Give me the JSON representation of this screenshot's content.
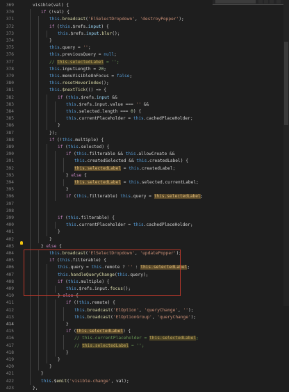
{
  "editor": {
    "active_line": 414,
    "find_widget": {
      "query": "this.selectedLabel"
    },
    "lines": [
      {
        "n": "369",
        "i": 1,
        "t": [
          [
            "p",
            "visible(val) {"
          ]
        ]
      },
      {
        "n": "370",
        "i": 2,
        "t": [
          [
            "c",
            "if"
          ],
          [
            "p",
            " (!val) {"
          ]
        ]
      },
      {
        "n": "371",
        "i": 3,
        "t": [
          [
            "k",
            "this"
          ],
          [
            "p",
            "."
          ],
          [
            "f",
            "broadcast"
          ],
          [
            "p",
            "("
          ],
          [
            "s",
            "'ElSelectDropdown'"
          ],
          [
            "p",
            ", "
          ],
          [
            "s",
            "'destroyPopper'"
          ],
          [
            "p",
            ");"
          ]
        ]
      },
      {
        "n": "372",
        "i": 3,
        "t": [
          [
            "c",
            "if"
          ],
          [
            "p",
            " ("
          ],
          [
            "k",
            "this"
          ],
          [
            "p",
            ".$refs."
          ],
          [
            "v",
            "input"
          ],
          [
            "p",
            ") {"
          ]
        ]
      },
      {
        "n": "373",
        "i": 4,
        "t": [
          [
            "k",
            "this"
          ],
          [
            "p",
            ".$refs."
          ],
          [
            "v",
            "input"
          ],
          [
            "p",
            "."
          ],
          [
            "f",
            "blur"
          ],
          [
            "p",
            "();"
          ]
        ]
      },
      {
        "n": "374",
        "i": 3,
        "t": [
          [
            "p",
            "}"
          ]
        ]
      },
      {
        "n": "375",
        "i": 3,
        "t": [
          [
            "k",
            "this"
          ],
          [
            "p",
            ".query = "
          ],
          [
            "s",
            "''"
          ],
          [
            "p",
            ";"
          ]
        ]
      },
      {
        "n": "376",
        "i": 3,
        "t": [
          [
            "k",
            "this"
          ],
          [
            "p",
            ".previousQuery = "
          ],
          [
            "k",
            "null"
          ],
          [
            "p",
            ";"
          ]
        ]
      },
      {
        "n": "377",
        "i": 3,
        "t": [
          [
            "cm",
            "// "
          ],
          [
            "hlc",
            "this.selectedLabel"
          ],
          [
            "cm",
            " = '';"
          ]
        ]
      },
      {
        "n": "378",
        "i": 3,
        "t": [
          [
            "k",
            "this"
          ],
          [
            "p",
            ".inputLength = "
          ],
          [
            "n",
            "20"
          ],
          [
            "p",
            ";"
          ]
        ]
      },
      {
        "n": "379",
        "i": 3,
        "t": [
          [
            "k",
            "this"
          ],
          [
            "p",
            ".menuVisibleOnFocus = "
          ],
          [
            "k",
            "false"
          ],
          [
            "p",
            ";"
          ]
        ]
      },
      {
        "n": "380",
        "i": 3,
        "t": [
          [
            "k",
            "this"
          ],
          [
            "p",
            "."
          ],
          [
            "f",
            "resetHoverIndex"
          ],
          [
            "p",
            "();"
          ]
        ]
      },
      {
        "n": "381",
        "i": 3,
        "t": [
          [
            "k",
            "this"
          ],
          [
            "p",
            "."
          ],
          [
            "f",
            "$nextTick"
          ],
          [
            "p",
            "(() => {"
          ]
        ]
      },
      {
        "n": "382",
        "i": 4,
        "t": [
          [
            "c",
            "if"
          ],
          [
            "p",
            " ("
          ],
          [
            "k",
            "this"
          ],
          [
            "p",
            ".$refs."
          ],
          [
            "v",
            "input"
          ],
          [
            "p",
            " &&"
          ]
        ]
      },
      {
        "n": "383",
        "i": 5,
        "t": [
          [
            "k",
            "this"
          ],
          [
            "p",
            ".$refs.input.value === "
          ],
          [
            "s",
            "''"
          ],
          [
            "p",
            " &&"
          ]
        ]
      },
      {
        "n": "384",
        "i": 5,
        "t": [
          [
            "k",
            "this"
          ],
          [
            "p",
            ".selected.length === "
          ],
          [
            "n",
            "0"
          ],
          [
            "p",
            ") {"
          ]
        ]
      },
      {
        "n": "385",
        "i": 5,
        "t": [
          [
            "k",
            "this"
          ],
          [
            "p",
            ".currentPlaceholder = "
          ],
          [
            "k",
            "this"
          ],
          [
            "p",
            ".cachedPlaceHolder;"
          ]
        ]
      },
      {
        "n": "386",
        "i": 4,
        "t": [
          [
            "p",
            "}"
          ]
        ]
      },
      {
        "n": "387",
        "i": 3,
        "t": [
          [
            "p",
            "});"
          ]
        ]
      },
      {
        "n": "388",
        "i": 3,
        "t": [
          [
            "c",
            "if"
          ],
          [
            "p",
            " (!"
          ],
          [
            "k",
            "this"
          ],
          [
            "p",
            ".multiple) {"
          ]
        ]
      },
      {
        "n": "389",
        "i": 4,
        "t": [
          [
            "c",
            "if"
          ],
          [
            "p",
            " ("
          ],
          [
            "k",
            "this"
          ],
          [
            "p",
            ".selected) {"
          ]
        ]
      },
      {
        "n": "390",
        "i": 5,
        "t": [
          [
            "c",
            "if"
          ],
          [
            "p",
            " ("
          ],
          [
            "k",
            "this"
          ],
          [
            "p",
            ".filterable && "
          ],
          [
            "k",
            "this"
          ],
          [
            "p",
            ".allowCreate &&"
          ]
        ]
      },
      {
        "n": "391",
        "i": 6,
        "t": [
          [
            "k",
            "this"
          ],
          [
            "p",
            ".createdSelected && "
          ],
          [
            "k",
            "this"
          ],
          [
            "p",
            ".createdLabel) {"
          ]
        ]
      },
      {
        "n": "392",
        "i": 6,
        "t": [
          [
            "hl",
            "this.selectedLabel"
          ],
          [
            "p",
            " = "
          ],
          [
            "k",
            "this"
          ],
          [
            "p",
            ".createdLabel;"
          ]
        ]
      },
      {
        "n": "393",
        "i": 5,
        "t": [
          [
            "p",
            "} "
          ],
          [
            "c",
            "else"
          ],
          [
            "p",
            " {"
          ]
        ]
      },
      {
        "n": "394",
        "i": 6,
        "t": [
          [
            "hl",
            "this.selectedLabel"
          ],
          [
            "p",
            " = "
          ],
          [
            "k",
            "this"
          ],
          [
            "p",
            ".selected.currentLabel;"
          ]
        ]
      },
      {
        "n": "395",
        "i": 5,
        "t": [
          [
            "p",
            "}"
          ]
        ]
      },
      {
        "n": "396",
        "i": 5,
        "t": [
          [
            "c",
            "if"
          ],
          [
            "p",
            " ("
          ],
          [
            "k",
            "this"
          ],
          [
            "p",
            ".filterable) "
          ],
          [
            "k",
            "this"
          ],
          [
            "p",
            ".query = "
          ],
          [
            "hl",
            "this.selectedLabel"
          ],
          [
            "p",
            ";"
          ]
        ]
      },
      {
        "n": "397",
        "i": 4,
        "t": []
      },
      {
        "n": "398",
        "i": 4,
        "t": []
      },
      {
        "n": "399",
        "i": 4,
        "t": [
          [
            "c",
            "if"
          ],
          [
            "p",
            " ("
          ],
          [
            "k",
            "this"
          ],
          [
            "p",
            ".filterable) {"
          ]
        ]
      },
      {
        "n": "400",
        "i": 5,
        "t": [
          [
            "k",
            "this"
          ],
          [
            "p",
            ".currentPlaceholder = "
          ],
          [
            "k",
            "this"
          ],
          [
            "p",
            ".cachedPlaceHolder;"
          ]
        ]
      },
      {
        "n": "401",
        "i": 4,
        "t": [
          [
            "p",
            "}"
          ]
        ]
      },
      {
        "n": "402",
        "i": 3,
        "t": [
          [
            "p",
            "}"
          ]
        ]
      },
      {
        "n": "403",
        "i": 2,
        "t": [
          [
            "p",
            "} "
          ],
          [
            "c",
            "else"
          ],
          [
            "p",
            " {"
          ]
        ]
      },
      {
        "n": "404",
        "i": 3,
        "t": [
          [
            "k",
            "this"
          ],
          [
            "p",
            "."
          ],
          [
            "f",
            "broadcast"
          ],
          [
            "p",
            "("
          ],
          [
            "s",
            "'ElSelectDropdown'"
          ],
          [
            "p",
            ", "
          ],
          [
            "s",
            "'updatePopper'"
          ],
          [
            "p",
            ");"
          ]
        ]
      },
      {
        "n": "405",
        "i": 3,
        "t": [
          [
            "c",
            "if"
          ],
          [
            "p",
            " ("
          ],
          [
            "k",
            "this"
          ],
          [
            "p",
            ".filterable) {"
          ]
        ]
      },
      {
        "n": "406",
        "i": 4,
        "t": [
          [
            "k",
            "this"
          ],
          [
            "p",
            ".query = "
          ],
          [
            "k",
            "this"
          ],
          [
            "p",
            ".remote ? "
          ],
          [
            "s",
            "''"
          ],
          [
            "p",
            " : "
          ],
          [
            "hl",
            "this.selectedLabel"
          ],
          [
            "p",
            ";"
          ]
        ]
      },
      {
        "n": "407",
        "i": 4,
        "t": [
          [
            "k",
            "this"
          ],
          [
            "p",
            "."
          ],
          [
            "f",
            "handleQueryChange"
          ],
          [
            "p",
            "("
          ],
          [
            "k",
            "this"
          ],
          [
            "p",
            ".query);"
          ]
        ]
      },
      {
        "n": "408",
        "i": 4,
        "t": [
          [
            "c",
            "if"
          ],
          [
            "p",
            " ("
          ],
          [
            "k",
            "this"
          ],
          [
            "p",
            ".multiple) {"
          ]
        ]
      },
      {
        "n": "409",
        "i": 5,
        "t": [
          [
            "k",
            "this"
          ],
          [
            "p",
            ".$refs.input."
          ],
          [
            "f",
            "focus"
          ],
          [
            "p",
            "();"
          ]
        ]
      },
      {
        "n": "410",
        "i": 4,
        "t": [
          [
            "p",
            "} "
          ],
          [
            "c",
            "else"
          ],
          [
            "p",
            " {"
          ]
        ]
      },
      {
        "n": "411",
        "i": 5,
        "t": [
          [
            "c",
            "if"
          ],
          [
            "p",
            " (!"
          ],
          [
            "k",
            "this"
          ],
          [
            "p",
            ".remote) {"
          ]
        ]
      },
      {
        "n": "412",
        "i": 6,
        "t": [
          [
            "k",
            "this"
          ],
          [
            "p",
            "."
          ],
          [
            "f",
            "broadcast"
          ],
          [
            "p",
            "("
          ],
          [
            "s",
            "'ElOption'"
          ],
          [
            "p",
            ", "
          ],
          [
            "s",
            "'queryChange'"
          ],
          [
            "p",
            ", "
          ],
          [
            "s",
            "''"
          ],
          [
            "p",
            ");"
          ]
        ]
      },
      {
        "n": "413",
        "i": 6,
        "t": [
          [
            "k",
            "this"
          ],
          [
            "p",
            "."
          ],
          [
            "f",
            "broadcast"
          ],
          [
            "p",
            "("
          ],
          [
            "s",
            "'ElOptionGroup'"
          ],
          [
            "p",
            ", "
          ],
          [
            "s",
            "'queryChange'"
          ],
          [
            "p",
            ");"
          ]
        ]
      },
      {
        "n": "414",
        "i": 5,
        "t": [
          [
            "p",
            "}"
          ]
        ]
      },
      {
        "n": "415",
        "i": 5,
        "t": [
          [
            "c",
            "if"
          ],
          [
            "p",
            " ("
          ],
          [
            "hl",
            "this.selectedLabel"
          ],
          [
            "p",
            ") {"
          ]
        ]
      },
      {
        "n": "416",
        "i": 6,
        "t": [
          [
            "cm",
            "// this.currentPlaceholder = "
          ],
          [
            "hlc",
            "this.selectedLabel"
          ],
          [
            "cm",
            ";"
          ]
        ]
      },
      {
        "n": "417",
        "i": 6,
        "t": [
          [
            "cm",
            "// "
          ],
          [
            "hlc",
            "this.selectedLabel"
          ],
          [
            "cm",
            " = '';"
          ]
        ]
      },
      {
        "n": "418",
        "i": 5,
        "t": [
          [
            "p",
            "}"
          ]
        ]
      },
      {
        "n": "419",
        "i": 4,
        "t": [
          [
            "p",
            "}"
          ]
        ]
      },
      {
        "n": "420",
        "i": 3,
        "t": [
          [
            "p",
            "}"
          ]
        ]
      },
      {
        "n": "421",
        "i": 2,
        "t": [
          [
            "p",
            "}"
          ]
        ]
      },
      {
        "n": "422",
        "i": 2,
        "t": [
          [
            "k",
            "this"
          ],
          [
            "p",
            ".$"
          ],
          [
            "f",
            "emit"
          ],
          [
            "p",
            "("
          ],
          [
            "s",
            "'visible-change'"
          ],
          [
            "p",
            ", val);"
          ]
        ]
      },
      {
        "n": "423",
        "i": 1,
        "t": [
          [
            "p",
            "},"
          ]
        ]
      }
    ]
  },
  "colors": {
    "background": "#1e1e1e",
    "selection_box": "#c0392b",
    "highlight": "#5b4a2a"
  },
  "icons": {
    "lightbulb": "lightbulb-icon"
  }
}
